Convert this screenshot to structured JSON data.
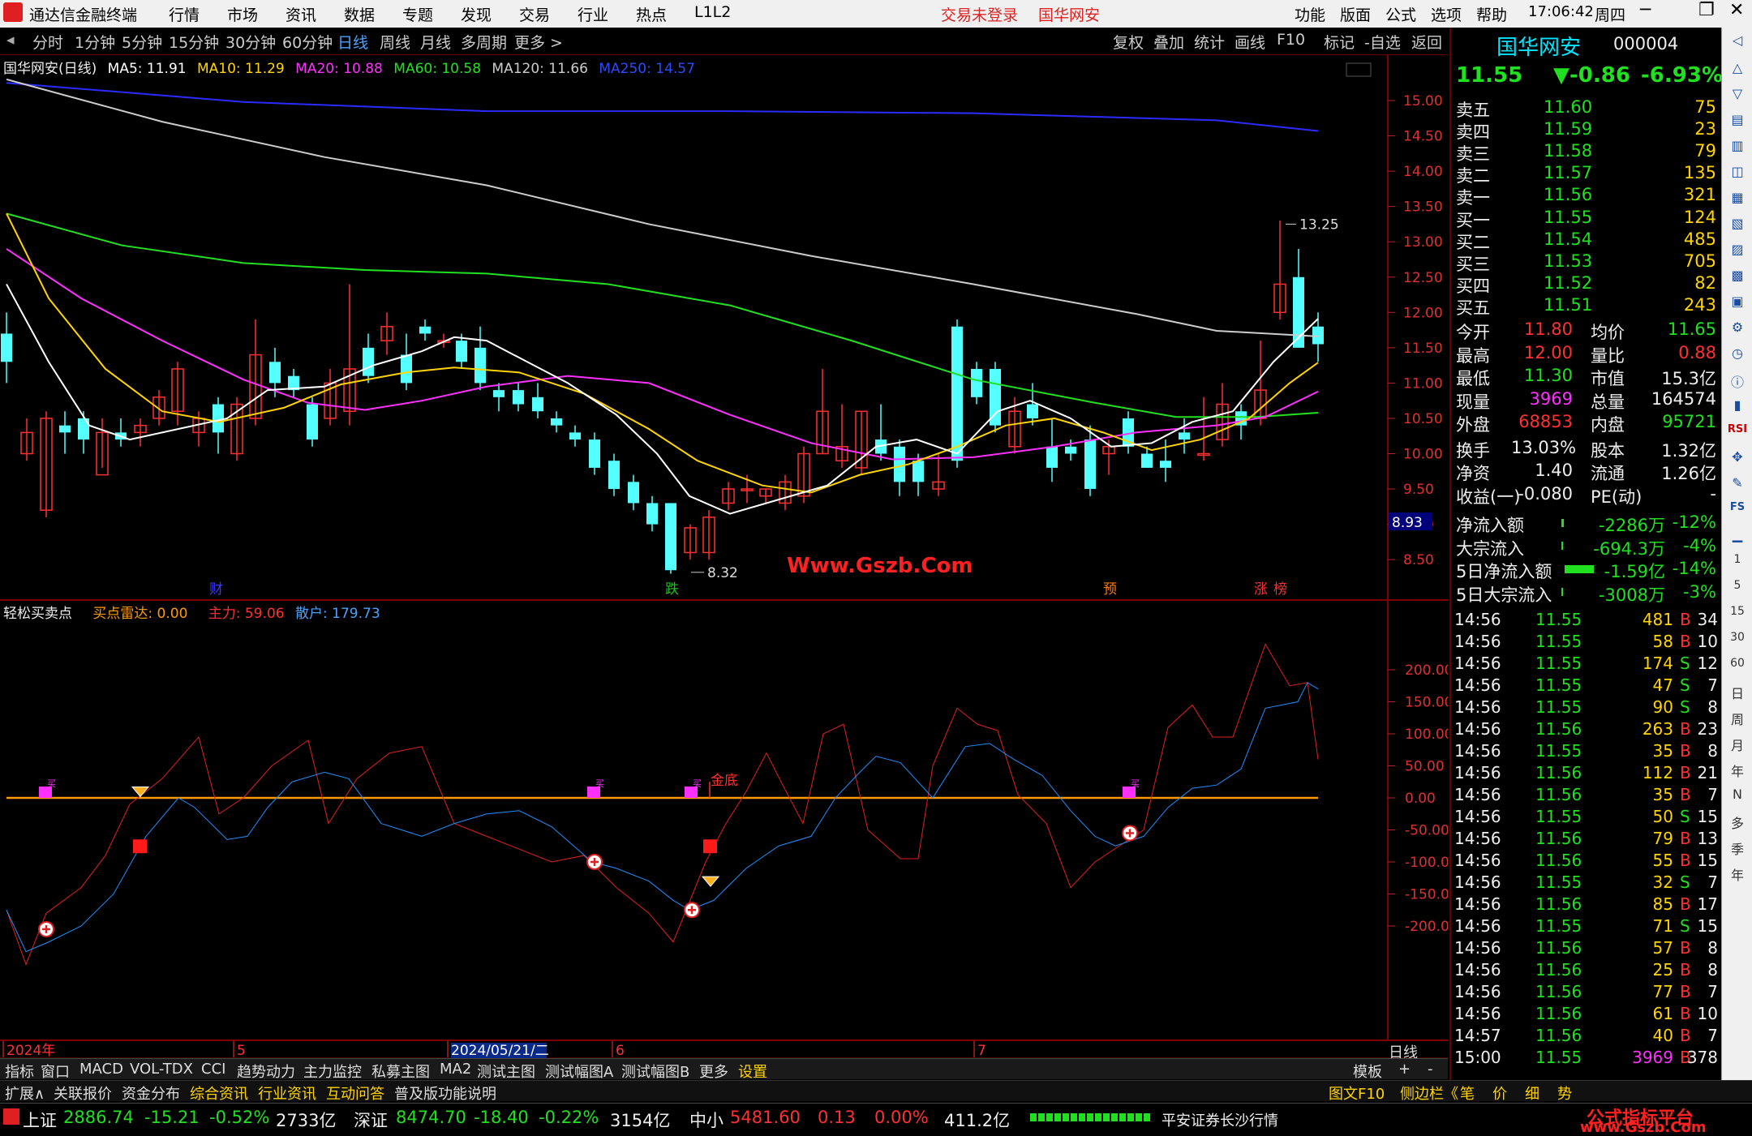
{
  "titlebar": {
    "app_title": "通达信金融终端",
    "menu": [
      "行情",
      "市场",
      "资讯",
      "数据",
      "专题",
      "发现",
      "交易",
      "行业",
      "热点",
      "L1L2"
    ],
    "trade_status": "交易未登录",
    "broker": "国华网安",
    "right_menu": [
      "功能",
      "版面",
      "公式",
      "选项",
      "帮助"
    ],
    "time": "17:06:42",
    "weekday": "周四"
  },
  "toolbar": {
    "periods": [
      "分时",
      "1分钟",
      "5分钟",
      "15分钟",
      "30分钟",
      "60分钟",
      "日线",
      "周线",
      "月线",
      "多周期",
      "更多 >"
    ],
    "active": "日线",
    "actions": [
      "复权",
      "叠加",
      "统计",
      "画线",
      "F10",
      "标记",
      "-自选",
      "返回"
    ]
  },
  "chart_header": {
    "stock": "国华网安(日线)",
    "ma": [
      {
        "label": "MA5: 11.91",
        "color": "#ffffff"
      },
      {
        "label": "MA10: 11.29",
        "color": "#ffd400"
      },
      {
        "label": "MA20: 10.88",
        "color": "#ff30ff"
      },
      {
        "label": "MA60: 10.58",
        "color": "#20e020"
      },
      {
        "label": "MA120: 11.66",
        "color": "#cccccc"
      },
      {
        "label": "MA250: 14.57",
        "color": "#2b4bff"
      }
    ]
  },
  "price_axis": [
    "15.00",
    "14.50",
    "14.00",
    "13.50",
    "13.00",
    "12.50",
    "12.00",
    "11.50",
    "11.00",
    "10.50",
    "10.00",
    "9.50",
    "9.00",
    "8.50"
  ],
  "current_price_tag": "8.93",
  "annotations": {
    "high": "13.25",
    "low": "8.32",
    "watermark": "Www.Gszb.Com",
    "markers": [
      "财",
      "跌",
      "预",
      "涨",
      "榜"
    ]
  },
  "indicator_header": {
    "name": "轻松买卖点",
    "buy_radar": "买点雷达: 0.00",
    "main_force": "主力: 59.06",
    "retail": "散户: 179.73"
  },
  "indicator_axis": [
    "200.00",
    "150.00",
    "100.00",
    "50.00",
    "0.00",
    "-50.00",
    "-100.00",
    "-150.00",
    "-200.00"
  ],
  "indicator_labels": {
    "gold_bottom": "金底",
    "buy_tags": [
      "买",
      "买",
      "买",
      "买",
      "买"
    ]
  },
  "date_axis": [
    "2024年",
    "5",
    "2024/05/21/二",
    "6",
    "7"
  ],
  "date_axis_right": "日线",
  "bottom_tabs": [
    "指标",
    "窗口",
    "MACD",
    "VOL-TDX",
    "CCI",
    "趋势动力",
    "主力监控",
    "私募主图",
    "MA2",
    "测试主图",
    "测试幅图A",
    "测试幅图B",
    "更多",
    "设置"
  ],
  "bottom_right": [
    "模板",
    "+",
    "-"
  ],
  "info_tabs": [
    "扩展∧",
    "关联报价",
    "资金分布",
    "综合资讯",
    "行业资讯",
    "互动问答",
    "普及版功能说明"
  ],
  "info_right": [
    "图文F10",
    "侧边栏《",
    "笔",
    "价",
    "细",
    "势"
  ],
  "status": {
    "sh_label": "上证",
    "sh": "2886.74",
    "sh_chg": "-15.21",
    "sh_pct": "-0.52%",
    "sh_amt": "2733亿",
    "sz_label": "深证",
    "sz": "8474.70",
    "sz_chg": "-18.40",
    "sz_pct": "-0.22%",
    "sz_amt": "3154亿",
    "zx_label": "中小",
    "zx": "5481.60",
    "zx_chg": "0.13",
    "zx_pct": "0.00%",
    "zx_amt": "411.2亿",
    "server": "平安证券长沙行情",
    "brand": "公式指标平台",
    "brand_url": "www.Gszb.Com"
  },
  "quote": {
    "name": "国华网安",
    "code": "000004",
    "price": "11.55",
    "change": "▼-0.86",
    "pct": "-6.93%",
    "asks": [
      {
        "l": "卖五",
        "p": "11.60",
        "v": "75"
      },
      {
        "l": "卖四",
        "p": "11.59",
        "v": "23"
      },
      {
        "l": "卖三",
        "p": "11.58",
        "v": "79"
      },
      {
        "l": "卖二",
        "p": "11.57",
        "v": "135"
      },
      {
        "l": "卖一",
        "p": "11.56",
        "v": "321"
      }
    ],
    "bids": [
      {
        "l": "买一",
        "p": "11.55",
        "v": "124"
      },
      {
        "l": "买二",
        "p": "11.54",
        "v": "485"
      },
      {
        "l": "买三",
        "p": "11.53",
        "v": "705"
      },
      {
        "l": "买四",
        "p": "11.52",
        "v": "82"
      },
      {
        "l": "买五",
        "p": "11.51",
        "v": "243"
      }
    ],
    "stats": [
      [
        "今开",
        "11.80",
        "均价",
        "11.65"
      ],
      [
        "最高",
        "12.00",
        "量比",
        "0.88"
      ],
      [
        "最低",
        "11.30",
        "市值",
        "15.3亿"
      ],
      [
        "现量",
        "3969",
        "总量",
        "164574"
      ],
      [
        "外盘",
        "68853",
        "内盘",
        "95721"
      ],
      [
        "换手",
        "13.03%",
        "股本",
        "1.32亿"
      ],
      [
        "净资",
        "1.40",
        "流通",
        "1.26亿"
      ],
      [
        "收益(一)",
        "-0.080",
        "PE(动)",
        "-"
      ]
    ],
    "flows": [
      [
        "净流入额",
        "-2286万",
        "-12%"
      ],
      [
        "大宗流入",
        "-694.3万",
        "-4%"
      ],
      [
        "5日净流入额",
        "-1.59亿",
        "-14%"
      ],
      [
        "5日大宗流入",
        "-3008万",
        "-3%"
      ]
    ],
    "ticks": [
      [
        "14:56",
        "11.55",
        "481",
        "B",
        "34"
      ],
      [
        "14:56",
        "11.55",
        "58",
        "B",
        "10"
      ],
      [
        "14:56",
        "11.55",
        "174",
        "S",
        "12"
      ],
      [
        "14:56",
        "11.55",
        "47",
        "S",
        "7"
      ],
      [
        "14:56",
        "11.55",
        "90",
        "S",
        "8"
      ],
      [
        "14:56",
        "11.56",
        "263",
        "B",
        "23"
      ],
      [
        "14:56",
        "11.55",
        "35",
        "B",
        "8"
      ],
      [
        "14:56",
        "11.56",
        "112",
        "B",
        "21"
      ],
      [
        "14:56",
        "11.56",
        "35",
        "B",
        "7"
      ],
      [
        "14:56",
        "11.55",
        "50",
        "S",
        "15"
      ],
      [
        "14:56",
        "11.56",
        "79",
        "B",
        "13"
      ],
      [
        "14:56",
        "11.56",
        "55",
        "B",
        "15"
      ],
      [
        "14:56",
        "11.55",
        "32",
        "S",
        "7"
      ],
      [
        "14:56",
        "11.56",
        "85",
        "B",
        "17"
      ],
      [
        "14:56",
        "11.55",
        "71",
        "S",
        "15"
      ],
      [
        "14:56",
        "11.56",
        "57",
        "B",
        "8"
      ],
      [
        "14:56",
        "11.56",
        "25",
        "B",
        "8"
      ],
      [
        "14:56",
        "11.56",
        "77",
        "B",
        "7"
      ],
      [
        "14:56",
        "11.56",
        "61",
        "B",
        "10"
      ],
      [
        "14:57",
        "11.56",
        "40",
        "B",
        "7"
      ],
      [
        "15:00",
        "11.55",
        "3969",
        "B",
        "378"
      ]
    ]
  },
  "sidebar": [
    "日",
    "周",
    "月",
    "年",
    "N",
    "多",
    "季",
    "年"
  ]
}
